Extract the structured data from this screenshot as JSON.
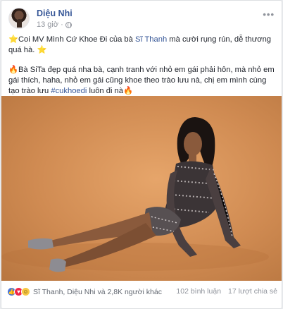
{
  "post": {
    "author": "Diệu Nhi",
    "time": "13 giờ",
    "privacy_icon": "globe-icon",
    "paragraph1": {
      "emoji_start": "⭐",
      "text_before_tag": "Coi MV Mình Cứ Khoe Đi của bà ",
      "tagged_user": "Sĩ Thanh",
      "text_after_tag": " mà cười rụng rún, dễ thương quá hà. ",
      "emoji_end": "⭐"
    },
    "paragraph2": {
      "emoji_start": "🔥",
      "text_before_hashtag": "Bà SiTa đẹp quá nha bà, cạnh tranh với nhỏ em gái phải hôn, mà nhỏ em gái thích, haha, nhỏ em gái cũng khoe theo trào lưu nà, chị em mình cùng tạo trào lưu ",
      "hashtag": "#cukhoedi",
      "text_after_hashtag": " luôn đi nà",
      "emoji_end": "🔥"
    }
  },
  "footer": {
    "reactions": [
      "like",
      "love",
      "haha"
    ],
    "reactors": "Sĩ Thanh, Diệu Nhi và 2,8K người khác",
    "comments": "102 bình luận",
    "shares": "17 lượt chia sẻ"
  },
  "colors": {
    "link": "#385898",
    "muted": "#90949c",
    "photo_background": "#d08b52",
    "like": "#4a76d9",
    "love": "#f0284a",
    "haha": "#f7c845"
  }
}
